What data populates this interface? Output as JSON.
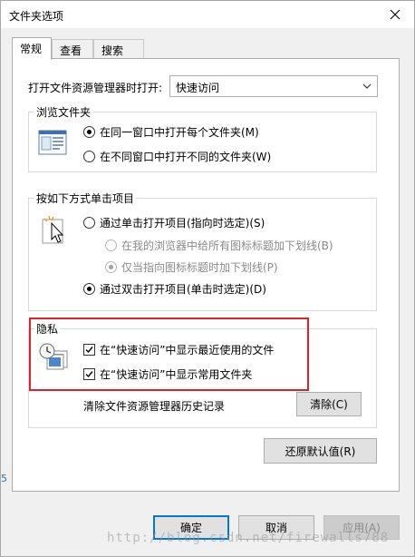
{
  "window": {
    "title": "文件夹选项"
  },
  "tabs": [
    {
      "label": "常规",
      "active": true
    },
    {
      "label": "查看",
      "active": false
    },
    {
      "label": "搜索",
      "active": false
    }
  ],
  "general": {
    "open_explorer_label": "打开文件资源管理器时打开:",
    "open_explorer_value": "快速访问",
    "browse": {
      "title": "浏览文件夹",
      "option_same": "在同一窗口中打开每个文件夹(M)",
      "option_new": "在不同窗口中打开不同的文件夹(W)",
      "selected": "same"
    },
    "click": {
      "title": "按如下方式单击项目",
      "option_single": "通过单击打开项目(指向时选定)(S)",
      "sub_browser": "在我的浏览器中给所有图标标题加下划线(B)",
      "sub_point": "仅当指向图标标题时加下划线(P)",
      "option_double": "通过双击打开项目(单击时选定)(D)",
      "selected": "double"
    },
    "privacy": {
      "title": "隐私",
      "show_recent": "在“快速访问”中显示最近使用的文件",
      "show_frequent": "在“快速访问”中显示常用文件夹",
      "show_recent_checked": true,
      "show_frequent_checked": true,
      "clear_label": "清除文件资源管理器历史记录",
      "clear_button": "清除(C)"
    },
    "restore_button": "还原默认值(R)"
  },
  "footer": {
    "ok": "确定",
    "cancel": "取消",
    "apply": "应用(A)"
  },
  "left_edge_char": "5",
  "watermark": "http://blog.csdn.net/firewalls788",
  "colors": {
    "highlight": "#e0202a",
    "accent": "#0078d7"
  },
  "icons": [
    "close-icon",
    "chevron-down-icon",
    "folder-window-icon",
    "pointer-click-icon",
    "clock-files-icon",
    "checkmark-icon"
  ]
}
